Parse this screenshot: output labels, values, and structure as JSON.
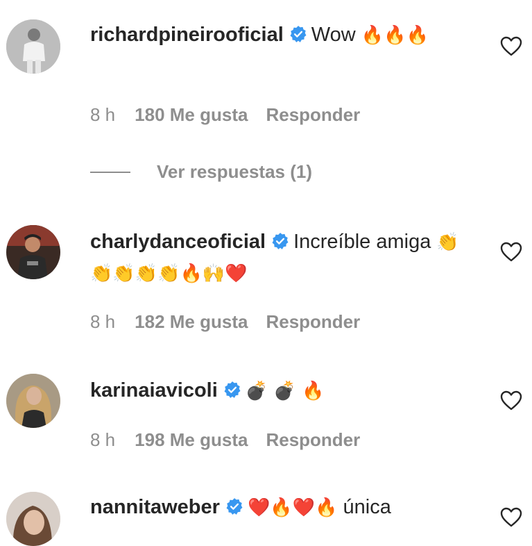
{
  "comments": [
    {
      "username": "richardpineirooficial",
      "text": "Wow",
      "emojis": "🔥🔥🔥",
      "time": "8 h",
      "likes": "180 Me gusta",
      "reply": "Responder",
      "view_replies": "Ver respuestas (1)"
    },
    {
      "username": "charlydanceoficial",
      "text": "Increíble amiga",
      "emojis": "👏👏👏👏👏🔥🙌❤️",
      "time": "8 h",
      "likes": "182 Me gusta",
      "reply": "Responder"
    },
    {
      "username": "karinaiavicoli",
      "text": "",
      "emojis": "💣 💣 🔥",
      "time": "8 h",
      "likes": "198 Me gusta",
      "reply": "Responder"
    },
    {
      "username": "nannitaweber",
      "text": "única",
      "emojis": "❤️🔥❤️🔥",
      "time": "",
      "likes": "",
      "reply": ""
    }
  ],
  "colors": {
    "text": "#262626",
    "secondary": "#8e8e8e",
    "verified": "#3897f0"
  },
  "icons": {
    "verified": "verified-badge-icon",
    "like": "heart-outline-icon"
  }
}
